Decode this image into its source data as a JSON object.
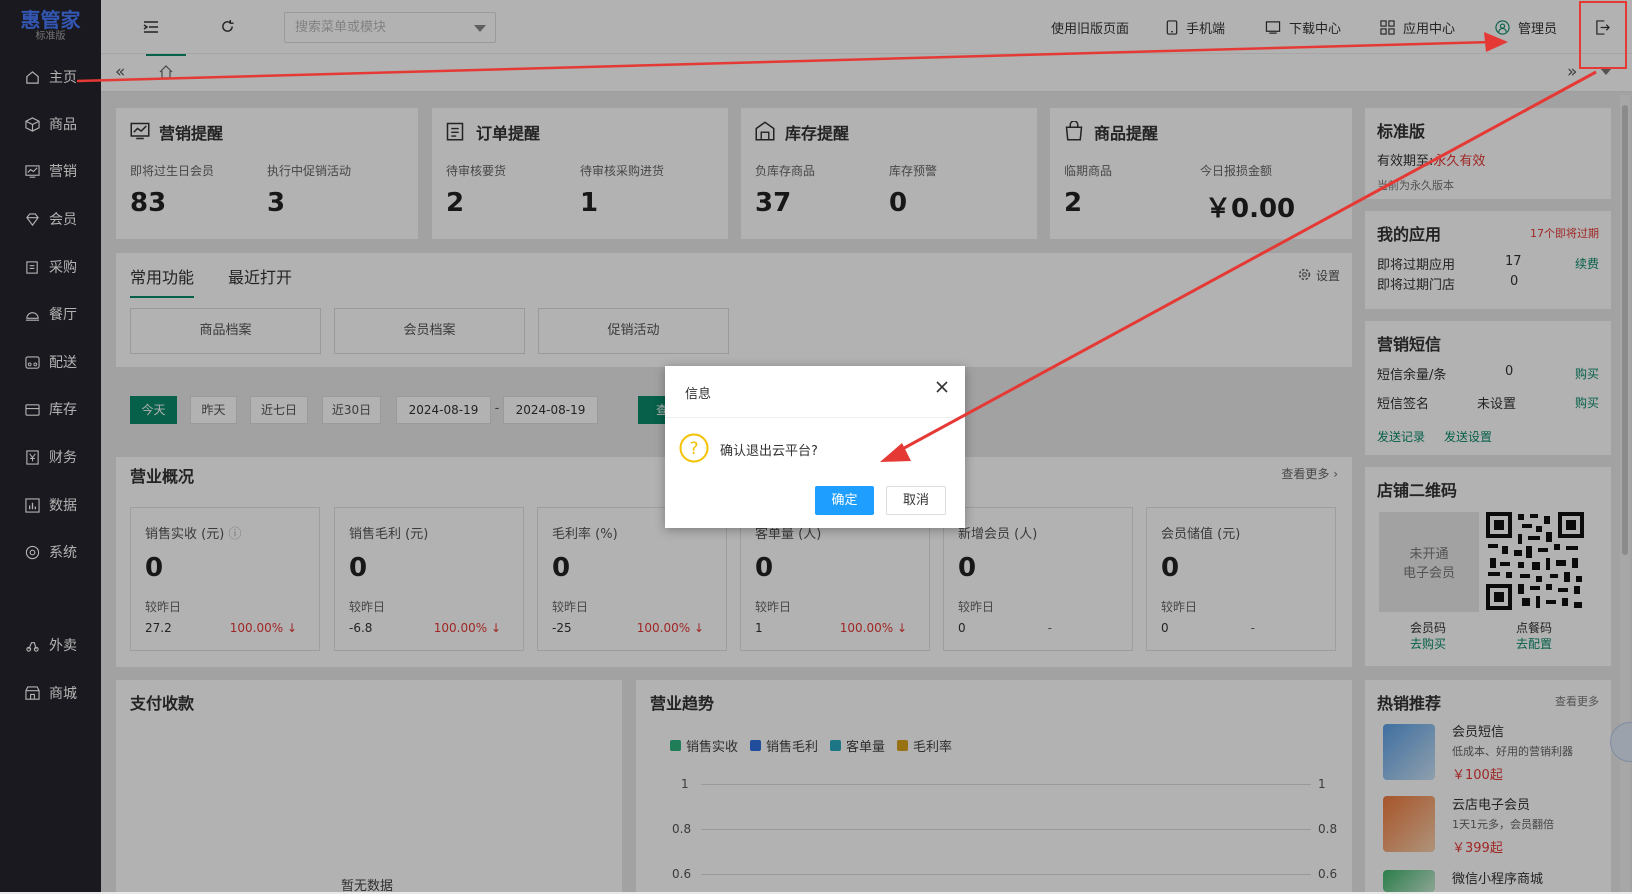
{
  "brand": {
    "name": "惠管家",
    "edition": "标准版"
  },
  "sidebar": {
    "items": [
      {
        "label": "主页",
        "icon": "home-icon"
      },
      {
        "label": "商品",
        "icon": "box-icon"
      },
      {
        "label": "营销",
        "icon": "chart-icon"
      },
      {
        "label": "会员",
        "icon": "diamond-icon"
      },
      {
        "label": "采购",
        "icon": "purchase-icon"
      },
      {
        "label": "餐厅",
        "icon": "cloche-icon"
      },
      {
        "label": "配送",
        "icon": "delivery-icon"
      },
      {
        "label": "库存",
        "icon": "inventory-icon"
      },
      {
        "label": "财务",
        "icon": "yen-icon"
      },
      {
        "label": "数据",
        "icon": "data-icon"
      },
      {
        "label": "系统",
        "icon": "gear-icon"
      },
      {
        "label": "外卖",
        "icon": "takeout-icon"
      },
      {
        "label": "商城",
        "icon": "store-icon"
      }
    ]
  },
  "topbar": {
    "search_placeholder": "搜索菜单或模块",
    "old_page": "使用旧版页面",
    "mobile": "手机端",
    "download": "下载中心",
    "apps": "应用中心",
    "user": "管理员"
  },
  "reminders": [
    {
      "title": "营销提醒",
      "items": [
        {
          "label": "即将过生日会员",
          "value": "83"
        },
        {
          "label": "执行中促销活动",
          "value": "3"
        }
      ]
    },
    {
      "title": "订单提醒",
      "items": [
        {
          "label": "待审核要货",
          "value": "2"
        },
        {
          "label": "待审核采购进货",
          "value": "1"
        }
      ]
    },
    {
      "title": "库存提醒",
      "items": [
        {
          "label": "负库存商品",
          "value": "37"
        },
        {
          "label": "库存预警",
          "value": "0"
        }
      ]
    },
    {
      "title": "商品提醒",
      "items": [
        {
          "label": "临期商品",
          "value": "2"
        },
        {
          "label": "今日报损金额",
          "value": "￥0.00"
        }
      ]
    }
  ],
  "functions": {
    "tab_common": "常用功能",
    "tab_recent": "最近打开",
    "settings": "设置",
    "buttons": [
      "商品档案",
      "会员档案",
      "促销活动"
    ]
  },
  "date_filter": {
    "buttons": [
      "今天",
      "昨天",
      "近七日",
      "近30日"
    ],
    "start": "2024-08-19",
    "sep": "-",
    "end": "2024-08-19",
    "query": "查询"
  },
  "overview": {
    "title": "营业概况",
    "more": "查看更多",
    "compare_label": "较昨日",
    "metrics": [
      {
        "title": "销售实收",
        "unit": "(元)",
        "value": "0",
        "yesterday": "27.2",
        "pct": "100.00% ↓"
      },
      {
        "title": "销售毛利",
        "unit": "(元)",
        "value": "0",
        "yesterday": "-6.8",
        "pct": "100.00% ↓"
      },
      {
        "title": "毛利率",
        "unit": "(%)",
        "value": "0",
        "yesterday": "-25",
        "pct": "100.00% ↓"
      },
      {
        "title": "客单量",
        "unit": "(人)",
        "value": "0",
        "yesterday": "1",
        "pct": "100.00% ↓"
      },
      {
        "title": "新增会员",
        "unit": "(人)",
        "value": "0",
        "yesterday": "0",
        "pct": "-"
      },
      {
        "title": "会员储值",
        "unit": "(元)",
        "value": "0",
        "yesterday": "0",
        "pct": "-"
      }
    ]
  },
  "payment": {
    "title": "支付收款",
    "empty": "暂无数据"
  },
  "trend": {
    "title": "营业趋势",
    "legend": [
      {
        "name": "销售实收",
        "color": "#2db37d"
      },
      {
        "name": "销售毛利",
        "color": "#2f6fe0"
      },
      {
        "name": "客单量",
        "color": "#2aa9c0"
      },
      {
        "name": "毛利率",
        "color": "#d9a21b"
      }
    ],
    "ticks_left": [
      "1",
      "0.8",
      "0.6"
    ],
    "ticks_right": [
      "1",
      "0.8",
      "0.6"
    ]
  },
  "right": {
    "edition": {
      "title": "标准版",
      "expiry_label": "有效期至:",
      "expiry_value": "永久有效",
      "note": "当前为永久版本"
    },
    "apps": {
      "title": "我的应用",
      "badge": "17个即将过期",
      "rows": [
        {
          "label": "即将过期应用",
          "value": "17",
          "action": "续费"
        },
        {
          "label": "即将过期门店",
          "value": "0",
          "action": ""
        }
      ]
    },
    "sms": {
      "title": "营销短信",
      "rows": [
        {
          "label": "短信余量/条",
          "value": "0",
          "action": "购买"
        },
        {
          "label": "短信签名",
          "value": "未设置",
          "action": "购买"
        }
      ],
      "links": [
        "发送记录",
        "发送设置"
      ]
    },
    "qr": {
      "title": "店铺二维码",
      "placeholder_line1": "未开通",
      "placeholder_line2": "电子会员",
      "member_code": "会员码",
      "member_action": "去购买",
      "order_code": "点餐码",
      "order_action": "去配置"
    },
    "hot": {
      "title": "热销推荐",
      "more": "查看更多",
      "items": [
        {
          "name": "会员短信",
          "desc": "低成本、好用的营销利器",
          "price": "￥100起"
        },
        {
          "name": "云店电子会员",
          "desc": "1天1元多，会员翻倍",
          "price": "￥399起"
        },
        {
          "name": "微信小程序商城",
          "desc": "",
          "price": ""
        }
      ]
    }
  },
  "dialog": {
    "title": "信息",
    "message": "确认退出云平台?",
    "ok": "确定",
    "cancel": "取消"
  },
  "colors": {
    "sidebar": "#24252d",
    "accent": "#0a8a6a",
    "primary": "#1e9fff",
    "alert": "#e53935"
  }
}
